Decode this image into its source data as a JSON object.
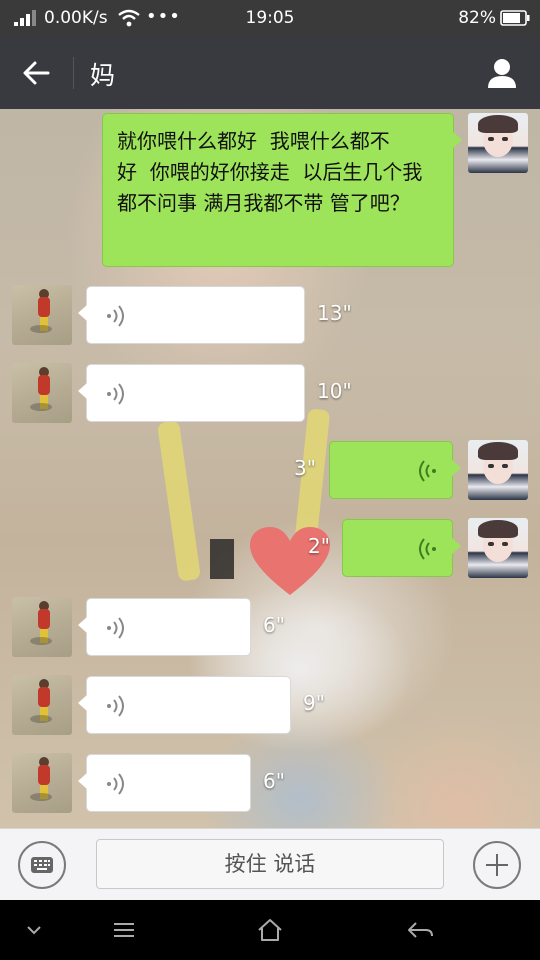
{
  "status_bar": {
    "speed": "0.00K/s",
    "dots": "•••",
    "time": "19:05",
    "battery": "82%"
  },
  "header": {
    "title": "妈"
  },
  "messages": [
    {
      "side": "right",
      "type": "text",
      "text": "就你喂什么都好  我喂什么都不好  你喂的好你接走  以后生几个我都不问事 满月我都不带 管了吧？"
    },
    {
      "side": "left",
      "type": "voice",
      "duration": "13\""
    },
    {
      "side": "left",
      "type": "voice",
      "duration": "10\""
    },
    {
      "side": "right",
      "type": "voice",
      "duration": "3\""
    },
    {
      "side": "right",
      "type": "voice",
      "duration": "2\""
    },
    {
      "side": "left",
      "type": "voice",
      "duration": "6\""
    },
    {
      "side": "left",
      "type": "voice",
      "duration": "9\""
    },
    {
      "side": "left",
      "type": "voice",
      "duration": "6\""
    }
  ],
  "input_bar": {
    "hold_to_talk": "按住 说话"
  },
  "colors": {
    "self_bubble": "#9ee45a",
    "other_bubble": "#ffffff",
    "title_bar": "#393a3f"
  }
}
